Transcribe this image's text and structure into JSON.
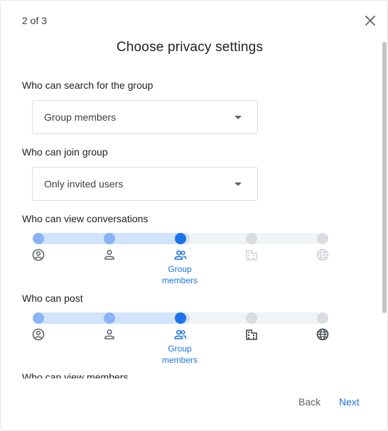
{
  "dialog": {
    "step": "2 of 3",
    "title": "Choose privacy settings"
  },
  "search_setting": {
    "label": "Who can search for the group",
    "value": "Group members"
  },
  "join_setting": {
    "label": "Who can join group",
    "value": "Only invited users"
  },
  "view_conversations": {
    "label": "Who can view conversations",
    "selected_caption": "Group members",
    "selected_index": 2
  },
  "post": {
    "label": "Who can post",
    "selected_caption": "Group members",
    "selected_index": 2
  },
  "view_members": {
    "label": "Who can view members"
  },
  "footer": {
    "back": "Back",
    "next": "Next"
  },
  "slider_levels": [
    "owners-icon",
    "managers-icon",
    "group-members-icon",
    "organization-icon",
    "public-web-icon"
  ],
  "colors": {
    "accent": "#1a73e8",
    "accent_light": "#8ab4f8",
    "track_fill": "#d2e3fc",
    "inactive": "#dadce0"
  }
}
